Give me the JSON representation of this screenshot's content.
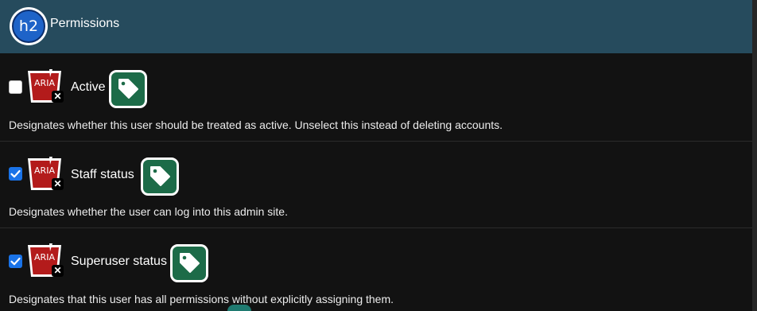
{
  "header": {
    "badge_text": "h2",
    "title": "Permissions"
  },
  "aria_badge_text": "ARIA",
  "aria_close_glyph": "✕",
  "permissions": [
    {
      "label": "Active",
      "checked": false,
      "help": "Designates whether this user should be treated as active. Unselect this instead of deleting accounts."
    },
    {
      "label": "Staff status",
      "checked": true,
      "help": "Designates whether the user can log into this admin site."
    },
    {
      "label": "Superuser status",
      "checked": true,
      "help": "Designates that this user has all permissions without explicitly assigning them."
    }
  ],
  "colors": {
    "header_bg": "#264b5d",
    "page_bg": "#121212",
    "checkbox_checked": "#1a73e8",
    "aria_red": "#b31b1b",
    "tag_green": "#1c6b48"
  },
  "icons": {
    "header": "h2-logo-icon",
    "aria": "aria-warning-icon",
    "tag": "tag-icon",
    "check": "check-icon"
  }
}
